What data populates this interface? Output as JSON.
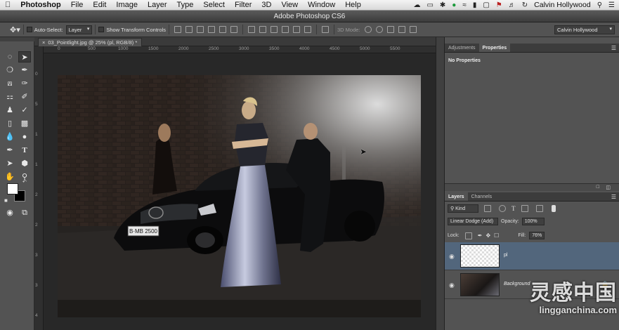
{
  "menubar": {
    "apple": "",
    "app_name": "Photoshop",
    "items": [
      "File",
      "Edit",
      "Image",
      "Layer",
      "Type",
      "Select",
      "Filter",
      "3D",
      "View",
      "Window",
      "Help"
    ],
    "user": "Calvin Hollywood"
  },
  "window": {
    "title": "Adobe Photoshop CS6"
  },
  "options_bar": {
    "auto_select_label": "Auto-Select:",
    "auto_select_value": "Layer",
    "show_transform_label": "Show Transform Controls",
    "mode_3d_label": "3D Mode:",
    "workspace_value": "Calvin Hollywood"
  },
  "document": {
    "tab_label": "03_Pointlight.jpg @ 25% (pl, RGB/8) *",
    "ruler_top": [
      "0",
      "500",
      "1000",
      "1500",
      "2000",
      "2500",
      "3000",
      "3500",
      "4000",
      "4500",
      "5000",
      "5500"
    ],
    "ruler_left": [
      "0",
      "5",
      "1",
      "1",
      "2",
      "2",
      "3",
      "3",
      "4"
    ]
  },
  "photo": {
    "plate_text": "B·MB 2500"
  },
  "properties_panel": {
    "tabs": [
      "Adjustments",
      "Properties"
    ],
    "active_tab": "Properties",
    "content": "No Properties"
  },
  "layers_panel": {
    "tabs": [
      "Layers",
      "Channels"
    ],
    "active_tab": "Layers",
    "filter_value": "Kind",
    "blend_mode": "Linear Dodge (Add)",
    "opacity_label": "Opacity:",
    "opacity_value": "100%",
    "lock_label": "Lock:",
    "fill_label": "Fill:",
    "fill_value": "76%",
    "layers": [
      {
        "name": "pl",
        "selected": true
      },
      {
        "name": "Background",
        "selected": false
      }
    ]
  },
  "watermark": {
    "brand": "灵感中国",
    "url": "lingganchina.com"
  },
  "colors": {
    "accent_selection": "#52667c",
    "panel_bg": "#535353",
    "canvas_bg": "#282828"
  }
}
